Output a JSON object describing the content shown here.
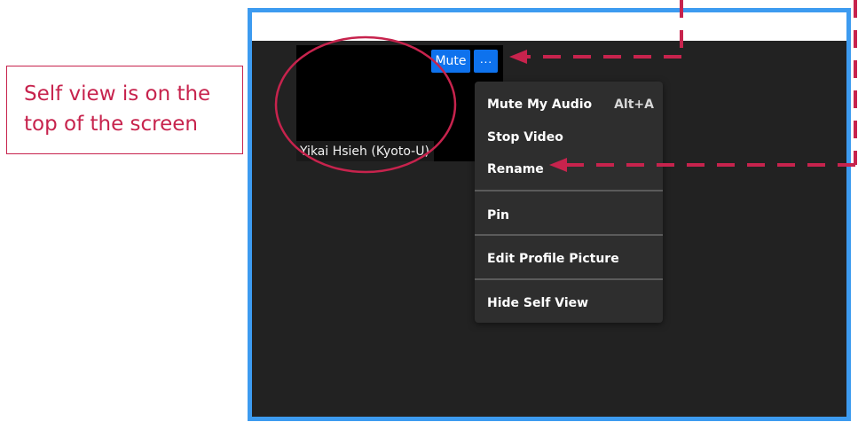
{
  "callout": {
    "line1": "Self view is on the",
    "line2": "top of the screen"
  },
  "self_view": {
    "name": "Yikai Hsieh (Kyoto-U)",
    "mute_label": "Mute",
    "more_label": "···",
    "more_icon": "ellipsis-icon"
  },
  "menu": {
    "items": [
      {
        "label": "Mute My Audio",
        "shortcut": "Alt+A"
      },
      {
        "label": "Stop Video"
      },
      {
        "label": "Rename"
      },
      {
        "label": "Pin"
      },
      {
        "label": "Edit Profile Picture"
      },
      {
        "label": "Hide Self View"
      }
    ]
  },
  "colors": {
    "annotation": "#c7234d",
    "frame_border": "#3d9bf0",
    "button_blue": "#0e72ed",
    "menu_bg": "#2e2e2e"
  }
}
